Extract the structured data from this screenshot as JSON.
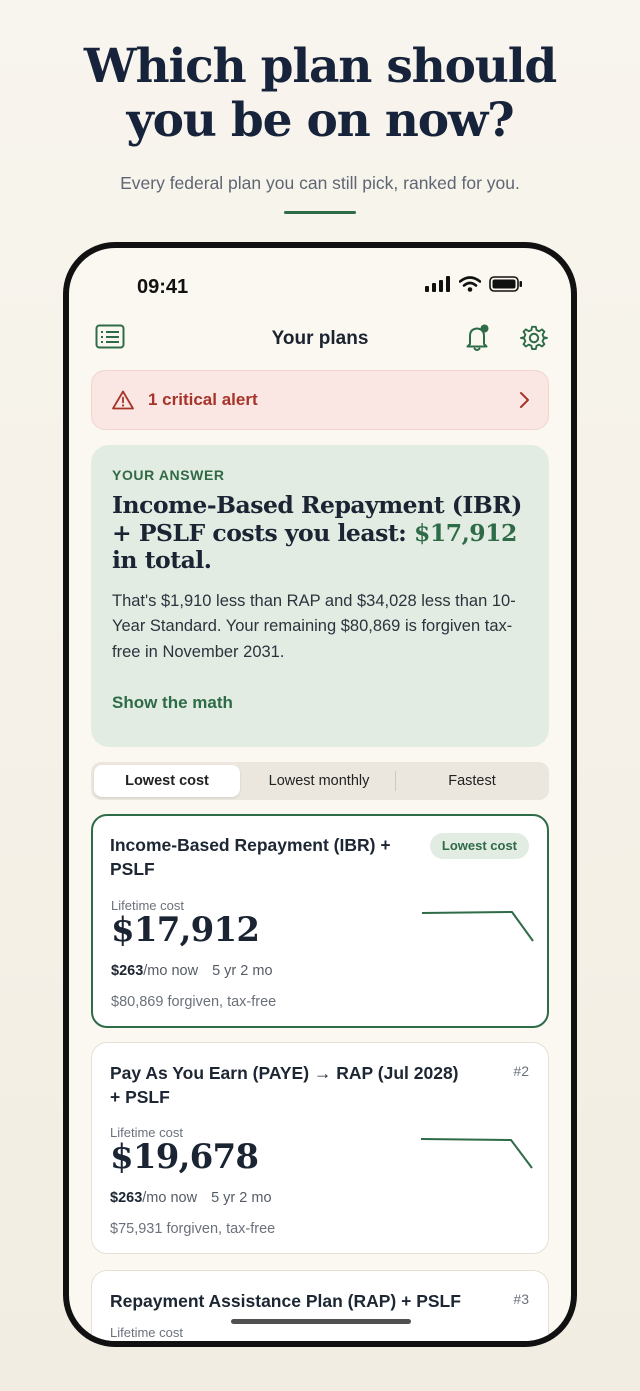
{
  "hero": {
    "title_line1": "Which plan should",
    "title_line2": "you be on now?",
    "subtitle": "Every federal plan you can still pick, ranked for you."
  },
  "status_bar": {
    "time": "09:41"
  },
  "nav": {
    "title": "Your plans"
  },
  "alert": {
    "text": "1 critical alert"
  },
  "answer": {
    "kicker": "YOUR ANSWER",
    "headline_pre": "Income-Based Repayment (IBR) + PSLF costs you least: ",
    "headline_amount": "$17,912",
    "headline_post": " in total.",
    "body": "That's $1,910 less than RAP and $34,028 less than 10-Year Standard. Your remaining $80,869 is forgiven tax-free in November 2031.",
    "link": "Show the math"
  },
  "segments": {
    "items": [
      "Lowest cost",
      "Lowest monthly",
      "Fastest"
    ],
    "selected": "Lowest cost"
  },
  "plans": [
    {
      "title": "Income-Based Repayment (IBR) + PSLF",
      "badge": "Lowest cost",
      "cost_label": "Lifetime cost",
      "cost": "$17,912",
      "monthly": "$263",
      "monthly_suffix": "/mo now",
      "duration": "5 yr 2 mo",
      "forgiven": "$80,869 forgiven, tax-free"
    },
    {
      "title": "Pay As You Earn (PAYE) → RAP (Jul 2028) + PSLF",
      "rank": "#2",
      "cost_label": "Lifetime cost",
      "cost": "$19,678",
      "monthly": "$263",
      "monthly_suffix": "/mo now",
      "duration": "5 yr 2 mo",
      "forgiven": "$75,931 forgiven, tax-free"
    },
    {
      "title": "Repayment Assistance Plan (RAP) + PSLF",
      "rank": "#3",
      "cost_label": "Lifetime cost"
    }
  ],
  "colors": {
    "accent": "#2e6b47",
    "alert_bg": "#fae6e3",
    "alert_text": "#a63428",
    "answer_bg": "#e3ece3"
  },
  "icons": [
    "menu-icon",
    "bell-icon",
    "gear-icon",
    "warning-icon",
    "chevron-right-icon",
    "signal-icon",
    "wifi-icon",
    "battery-icon"
  ]
}
